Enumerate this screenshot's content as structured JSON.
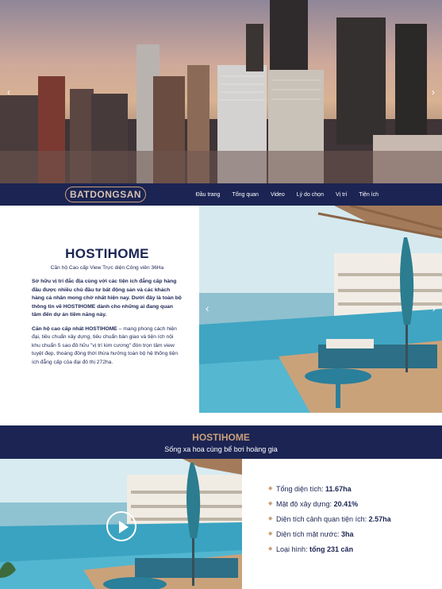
{
  "nav": {
    "logo": "BATDONGSAN",
    "items": [
      "Đầu trang",
      "Tổng quan",
      "Video",
      "Lý do chọn",
      "Vị trí",
      "Tiện ích"
    ]
  },
  "hero": {
    "prev_icon": "‹",
    "next_icon": "›"
  },
  "intro": {
    "title": "HOSTIHOME",
    "subtitle": "Căn hộ Cao cấp View Trực diện Công viên 36Ha",
    "paragraph1": "Sở hữu vị trí đắc địa cùng với các tiện ích đẳng cấp hàng đầu được nhiều chủ đầu tư bất động sản và các khách hàng cá nhân mong chờ nhất hiện nay. Dưới đây là toàn bộ thông tin về HOSTIHOME dành cho những ai đang quan tâm đến dự án tiềm năng này.",
    "paragraph2_bold": "Căn hộ cao cấp nhất HOSTIHOME",
    "paragraph2_rest": " – mang phong cách hiện đại, tiêu chuẩn xây dựng, tiêu chuẩn bàn giao và tiện ích nội khu chuẩn 5 sao đô hữu \"vị trí kim cương\" đón trọn tâm view tuyệt đẹp, thoáng đồng thời thừa hưởng toàn bộ hệ thống tiện ích đẳng cấp của đại đô thị 272ha.",
    "prev_icon": "‹",
    "next_icon": "›"
  },
  "band": {
    "title": "HOSTIHOME",
    "subtitle": "Sống xa hoa cùng bể bơi hoàng gia"
  },
  "features": [
    {
      "label": "Tổng diện tích: ",
      "value": "11.67ha"
    },
    {
      "label": "Mật độ xây dựng: ",
      "value": "20.41%"
    },
    {
      "label": "Diện tích cảnh quan tiện ích: ",
      "value": "2.57ha"
    },
    {
      "label": "Diện tích mặt nước: ",
      "value": "3ha"
    },
    {
      "label": "Loại hình: ",
      "value": "tổng 231 căn"
    }
  ],
  "colors": {
    "navy": "#1b2453",
    "gold": "#c9a07a"
  },
  "icons": {
    "bullet": "diamond-icon",
    "video": "play-icon"
  }
}
